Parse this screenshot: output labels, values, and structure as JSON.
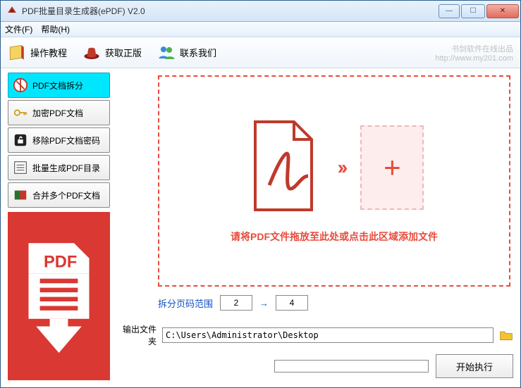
{
  "window": {
    "title": "PDF批量目录生成器(ePDF) V2.0"
  },
  "menubar": {
    "file": "文件(F)",
    "help": "帮助(H)"
  },
  "toolbar": {
    "tutorial": "操作教程",
    "getFull": "获取正版",
    "contact": "联系我们",
    "brand_line1": "书剑软件在线出品",
    "brand_url": "http://www.my201.com"
  },
  "sidebar": {
    "items": [
      {
        "label": "PDF文档拆分"
      },
      {
        "label": "加密PDF文档"
      },
      {
        "label": "移除PDF文档密码"
      },
      {
        "label": "批量生成PDF目录"
      },
      {
        "label": "合并多个PDF文档"
      }
    ]
  },
  "dropzone": {
    "text": "请将PDF文件拖放至此处或点击此区域添加文件"
  },
  "page_range": {
    "label": "拆分页码范围",
    "from": "2",
    "to": "4"
  },
  "output": {
    "label": "输出文件夹",
    "path": "C:\\Users\\Administrator\\Desktop"
  },
  "exec": {
    "label": "开始执行"
  }
}
